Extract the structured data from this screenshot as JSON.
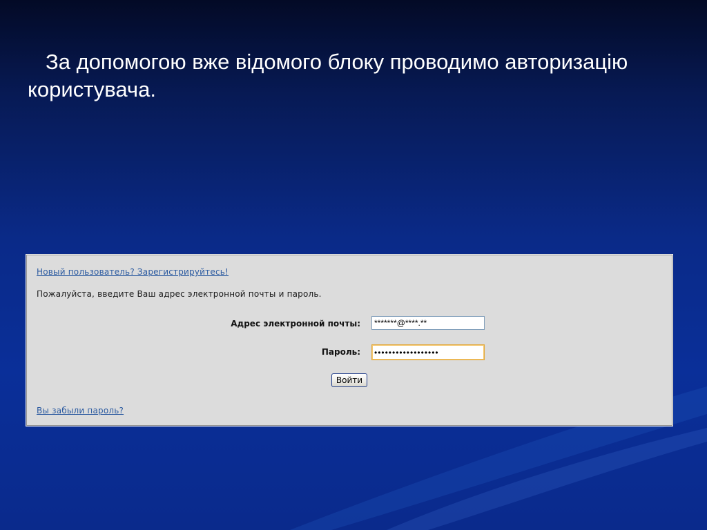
{
  "slide": {
    "caption": "За допомогою вже відомого блоку проводимо авторизацію користувача."
  },
  "login_form": {
    "register_link": "Новый пользователь? Зарегистрируйтесь!",
    "instructions": "Пожалуйста, введите Ваш адрес электронной почты и пароль.",
    "email_label": "Адрес электронной почты:",
    "email_value": "*******@****.**",
    "password_label": "Пароль:",
    "password_value": "••••••••••••••••••",
    "submit_label": "Войти",
    "forgot_link": "Вы забыли пароль?"
  },
  "colors": {
    "background": "#0a2a88",
    "panel": "#dcdcdc",
    "link": "#2b5aa0",
    "focus_border": "#e1a73a"
  }
}
